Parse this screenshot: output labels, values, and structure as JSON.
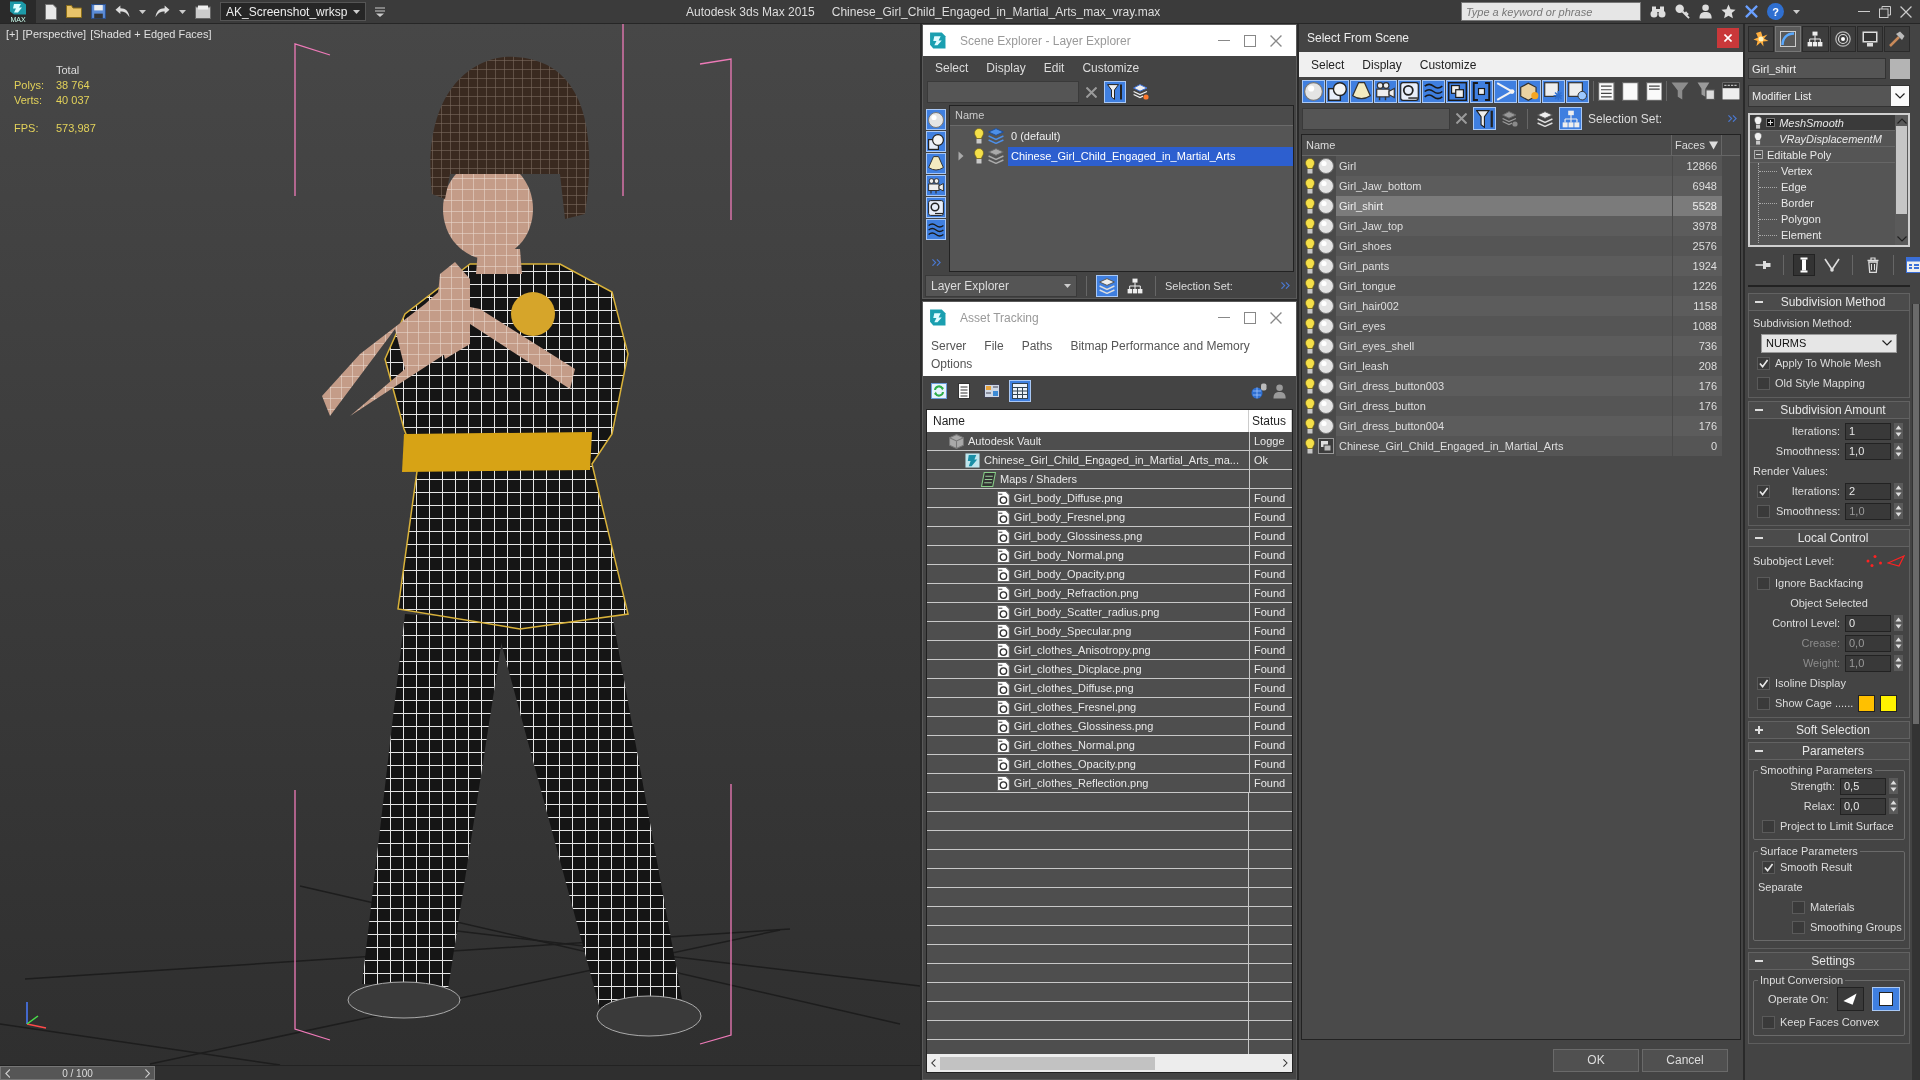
{
  "title_bar": {
    "badge": "MAX",
    "workspace": "AK_Screenshot_wrksp",
    "app": "Autodesk 3ds Max 2015",
    "file": "Chinese_Girl_Child_Engaged_in_Martial_Arts_max_vray.max",
    "search": {
      "placeholder": "Type a keyword or phrase"
    },
    "help": "?"
  },
  "viewport": {
    "labels": [
      "[+]",
      "[Perspective]",
      "[Shaded + Edged Faces]"
    ],
    "stats_heading": "Total",
    "stats": [
      {
        "label": "Polys:",
        "value": "38 764"
      },
      {
        "label": "Verts:",
        "value": "40 037"
      }
    ],
    "fps": {
      "label": "FPS:",
      "value": "573,987"
    }
  },
  "timeline": {
    "frame": "0 / 100",
    "level": 0
  },
  "scene_explorer": {
    "title": "Scene Explorer - Layer Explorer",
    "menu": [
      "Select",
      "Display",
      "Edit",
      "Customize"
    ],
    "filter_toggle": {
      "on": true
    },
    "side_filters": [
      {
        "kind": "geometry",
        "on": true
      },
      {
        "kind": "shape",
        "on": true
      },
      {
        "kind": "light",
        "on": true
      },
      {
        "kind": "camera",
        "on": true
      },
      {
        "kind": "helper",
        "on": true
      },
      {
        "kind": "spacewarp",
        "on": true
      }
    ],
    "column": "Name",
    "layers": [
      {
        "name": "0 (default)",
        "current": true,
        "selected": false
      },
      {
        "name": "Chinese_Girl_Child_Engaged_in_Martial_Arts",
        "expanded": false,
        "current": false,
        "selected": true
      }
    ],
    "explorer_type": "Layer Explorer",
    "view_toggles": [
      {
        "kind": "layers",
        "on": true
      },
      {
        "kind": "hierarchy",
        "on": false
      }
    ],
    "selection_set": "Selection Set:"
  },
  "asset_tracking": {
    "title": "Asset Tracking",
    "menu": [
      "Server",
      "File",
      "Paths",
      "Bitmap Performance and Memory",
      "Options"
    ],
    "view_toggles": [
      {
        "kind": "list",
        "on": false
      },
      {
        "kind": "thumbnails",
        "on": false
      },
      {
        "kind": "table",
        "on": true
      }
    ],
    "columns": [
      "Name",
      "Status"
    ],
    "tree": [
      {
        "kind": "vault",
        "name": "Autodesk Vault",
        "status": "Logge",
        "children": [
          {
            "kind": "scene",
            "name": "Chinese_Girl_Child_Engaged_in_Martial_Arts_ma...",
            "status": "Ok",
            "children": [
              {
                "kind": "folder",
                "name": "Maps / Shaders",
                "children": [
                  {
                    "kind": "bitmap",
                    "name": "Girl_body_Diffuse.png",
                    "status": "Found"
                  },
                  {
                    "kind": "bitmap",
                    "name": "Girl_body_Fresnel.png",
                    "status": "Found"
                  },
                  {
                    "kind": "bitmap",
                    "name": "Girl_body_Glossiness.png",
                    "status": "Found"
                  },
                  {
                    "kind": "bitmap",
                    "name": "Girl_body_Normal.png",
                    "status": "Found"
                  },
                  {
                    "kind": "bitmap",
                    "name": "Girl_body_Opacity.png",
                    "status": "Found"
                  },
                  {
                    "kind": "bitmap",
                    "name": "Girl_body_Refraction.png",
                    "status": "Found"
                  },
                  {
                    "kind": "bitmap",
                    "name": "Girl_body_Scatter_radius.png",
                    "status": "Found"
                  },
                  {
                    "kind": "bitmap",
                    "name": "Girl_body_Specular.png",
                    "status": "Found"
                  },
                  {
                    "kind": "bitmap",
                    "name": "Girl_clothes_Anisotropy.png",
                    "status": "Found"
                  },
                  {
                    "kind": "bitmap",
                    "name": "Girl_clothes_Dicplace.png",
                    "status": "Found"
                  },
                  {
                    "kind": "bitmap",
                    "name": "Girl_clothes_Diffuse.png",
                    "status": "Found"
                  },
                  {
                    "kind": "bitmap",
                    "name": "Girl_clothes_Fresnel.png",
                    "status": "Found"
                  },
                  {
                    "kind": "bitmap",
                    "name": "Girl_clothes_Glossiness.png",
                    "status": "Found"
                  },
                  {
                    "kind": "bitmap",
                    "name": "Girl_clothes_Normal.png",
                    "status": "Found"
                  },
                  {
                    "kind": "bitmap",
                    "name": "Girl_clothes_Opacity.png",
                    "status": "Found"
                  },
                  {
                    "kind": "bitmap",
                    "name": "Girl_clothes_Reflection.png",
                    "status": "Found"
                  }
                ]
              }
            ]
          }
        ]
      }
    ]
  },
  "select_from_scene": {
    "title": "Select From Scene",
    "menu": [
      "Select",
      "Display",
      "Customize"
    ],
    "filters": [
      {
        "kind": "geometry",
        "on": true
      },
      {
        "kind": "shape",
        "on": true
      },
      {
        "kind": "light",
        "on": true
      },
      {
        "kind": "camera",
        "on": true
      },
      {
        "kind": "helper",
        "on": true
      },
      {
        "kind": "spacewarp",
        "on": true
      },
      {
        "kind": "group",
        "on": true
      },
      {
        "kind": "xref",
        "on": true
      },
      {
        "kind": "bone",
        "on": true
      },
      {
        "kind": "container",
        "on": true
      },
      {
        "kind": "frozen",
        "on": true
      },
      {
        "kind": "hidden",
        "on": true
      }
    ],
    "filter_toggle": {
      "on": true
    },
    "hierarchy_toggle": {
      "on": true
    },
    "selection_set": "Selection Set:",
    "columns": [
      {
        "label": "Name"
      },
      {
        "label": "Faces",
        "sort_descending": true
      }
    ],
    "objects": [
      {
        "name": "Girl",
        "faces": "12866",
        "kind": "geometry",
        "selected": false
      },
      {
        "name": "Girl_Jaw_bottom",
        "faces": "6948",
        "kind": "geometry",
        "selected": false
      },
      {
        "name": "Girl_shirt",
        "faces": "5528",
        "kind": "geometry",
        "selected": true
      },
      {
        "name": "Girl_Jaw_top",
        "faces": "3978",
        "kind": "geometry",
        "selected": false
      },
      {
        "name": "Girl_shoes",
        "faces": "2576",
        "kind": "geometry",
        "selected": false
      },
      {
        "name": "Girl_pants",
        "faces": "1924",
        "kind": "geometry",
        "selected": false
      },
      {
        "name": "Girl_tongue",
        "faces": "1226",
        "kind": "geometry",
        "selected": false
      },
      {
        "name": "Girl_hair002",
        "faces": "1158",
        "kind": "geometry",
        "selected": false
      },
      {
        "name": "Girl_eyes",
        "faces": "1088",
        "kind": "geometry",
        "selected": false
      },
      {
        "name": "Girl_eyes_shell",
        "faces": "736",
        "kind": "geometry",
        "selected": false
      },
      {
        "name": "Girl_leash",
        "faces": "208",
        "kind": "geometry",
        "selected": false
      },
      {
        "name": "Girl_dress_button003",
        "faces": "176",
        "kind": "geometry",
        "selected": false
      },
      {
        "name": "Girl_dress_button",
        "faces": "176",
        "kind": "geometry",
        "selected": false
      },
      {
        "name": "Girl_dress_button004",
        "faces": "176",
        "kind": "geometry",
        "selected": false
      },
      {
        "name": "Chinese_Girl_Child_Engaged_in_Martial_Arts",
        "faces": "0",
        "kind": "group",
        "selected": false
      }
    ],
    "buttons": [
      "OK",
      "Cancel"
    ]
  },
  "command_panel": {
    "tabs": [
      {
        "kind": "create",
        "selected": false
      },
      {
        "kind": "modify",
        "selected": true
      },
      {
        "kind": "hierarchy",
        "selected": false
      },
      {
        "kind": "motion",
        "selected": false
      },
      {
        "kind": "display",
        "selected": false
      },
      {
        "kind": "utilities",
        "selected": false
      }
    ],
    "object_name": "Girl_shirt",
    "modifier_list": "Modifier List",
    "stack": [
      {
        "name": "MeshSmooth",
        "kind": "modifier",
        "expanded": false,
        "selected": true
      },
      {
        "name": "VRayDisplacementM",
        "kind": "modifier",
        "selected": false
      },
      {
        "name": "Editable Poly",
        "kind": "object",
        "expanded": true,
        "selected": false,
        "children": [
          {
            "name": "Vertex"
          },
          {
            "name": "Edge"
          },
          {
            "name": "Border"
          },
          {
            "name": "Polygon"
          },
          {
            "name": "Element"
          }
        ]
      }
    ],
    "stack_tools": [
      {
        "kind": "pin",
        "on": false
      },
      {
        "kind": "end_result",
        "on": true
      },
      {
        "kind": "make_unique",
        "on": false
      },
      {
        "kind": "remove",
        "on": false
      },
      {
        "kind": "configure",
        "on": false
      }
    ],
    "rollouts": [
      {
        "title": "Subdivision Method",
        "expanded": true,
        "items": [
          {
            "kind": "label",
            "text": "Subdivision Method:"
          },
          {
            "kind": "dropdown",
            "value": "NURMS"
          },
          {
            "kind": "checkbox",
            "label": "Apply To Whole Mesh",
            "checked": true
          },
          {
            "kind": "checkbox",
            "label": "Old Style Mapping",
            "checked": false
          }
        ]
      },
      {
        "title": "Subdivision Amount",
        "expanded": true,
        "items": [
          {
            "kind": "spinner",
            "label": "Iterations:",
            "value": "1",
            "disabled": false
          },
          {
            "kind": "spinner",
            "label": "Smoothness:",
            "value": "1,0",
            "disabled": false
          },
          {
            "kind": "label",
            "text": "Render Values:"
          },
          {
            "kind": "check_spinner",
            "label": "Iterations:",
            "value": "2",
            "checked": true,
            "disabled": false
          },
          {
            "kind": "check_spinner",
            "label": "Smoothness:",
            "value": "1,0",
            "checked": false,
            "disabled": true
          }
        ]
      },
      {
        "title": "Local Control",
        "expanded": true,
        "items": [
          {
            "kind": "subobject",
            "label": "Subobject Level:"
          },
          {
            "kind": "checkbox",
            "label": "Ignore Backfacing",
            "checked": false
          },
          {
            "kind": "note",
            "text": "Object Selected"
          },
          {
            "kind": "spinner",
            "label": "Control Level:",
            "value": "0",
            "disabled": false
          },
          {
            "kind": "spinner",
            "label": "Crease:",
            "value": "0,0",
            "disabled": true
          },
          {
            "kind": "spinner",
            "label": "Weight:",
            "value": "1,0",
            "disabled": true
          },
          {
            "kind": "checkbox",
            "label": "Isoline Display",
            "checked": true
          },
          {
            "kind": "cage",
            "label": "Show Cage ......",
            "checked": false,
            "swatches": [
              {
                "color": "#ffc000"
              },
              {
                "color": "#fff200"
              }
            ]
          }
        ]
      },
      {
        "title": "Soft Selection",
        "expanded": false
      },
      {
        "title": "Parameters",
        "expanded": true,
        "items": [
          {
            "kind": "group",
            "title": "Smoothing Parameters",
            "items": [
              {
                "kind": "spinner",
                "label": "Strength:",
                "value": "0,5",
                "disabled": false
              },
              {
                "kind": "spinner",
                "label": "Relax:",
                "value": "0,0",
                "disabled": false
              },
              {
                "kind": "checkbox",
                "label": "Project to Limit Surface",
                "checked": false
              }
            ]
          },
          {
            "kind": "group",
            "title": "Surface Parameters",
            "items": [
              {
                "kind": "checkbox",
                "label": "Smooth Result",
                "checked": true
              },
              {
                "kind": "label",
                "text": "Separate",
                "children": [
                  {
                    "kind": "checkbox",
                    "label": "Materials",
                    "checked": false
                  },
                  {
                    "kind": "checkbox",
                    "label": "Smoothing Groups",
                    "checked": false
                  }
                ]
              }
            ]
          }
        ]
      },
      {
        "title": "Settings",
        "expanded": true,
        "items": [
          {
            "kind": "group",
            "title": "Input Conversion",
            "items": [
              {
                "kind": "operate",
                "label": "Operate On:",
                "options": [
                  {
                    "kind": "triangle",
                    "selected": false
                  },
                  {
                    "kind": "polygon",
                    "selected": true
                  }
                ]
              },
              {
                "kind": "checkbox",
                "label": "Keep Faces Convex",
                "checked": false
              }
            ]
          }
        ]
      }
    ]
  }
}
